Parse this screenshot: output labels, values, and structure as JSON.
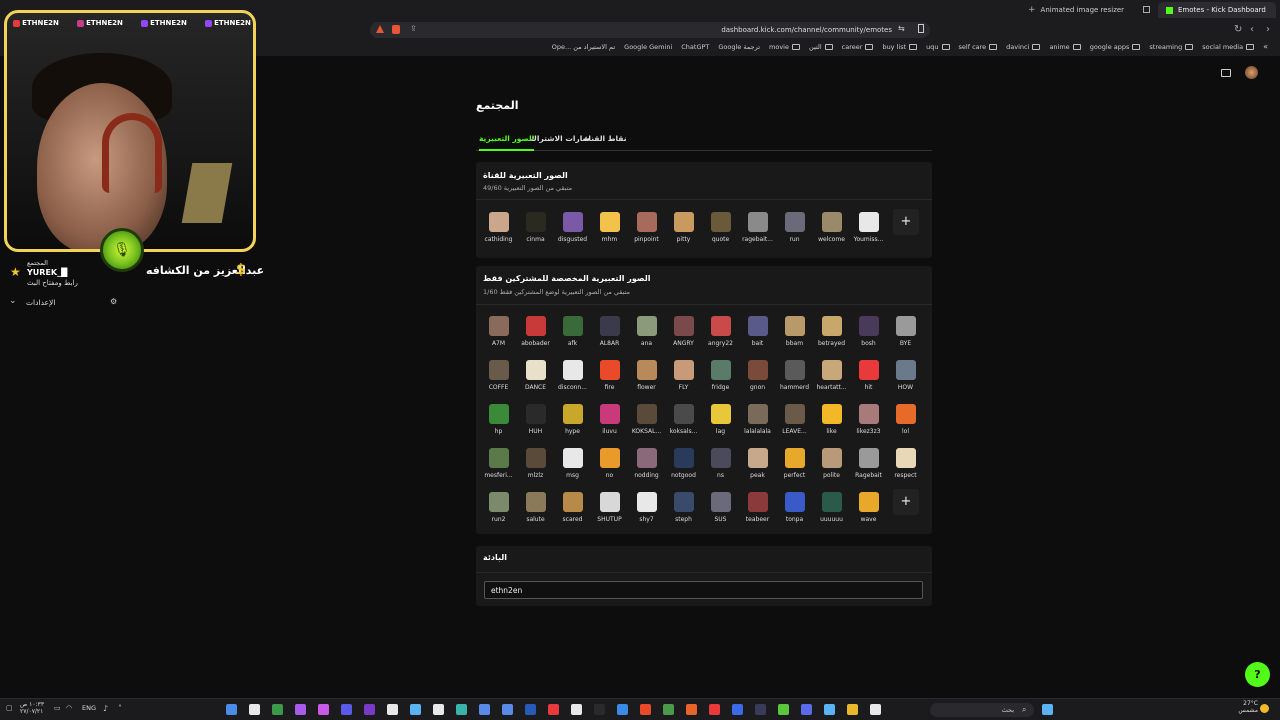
{
  "browser": {
    "tabs": [
      {
        "label": "Animated image resizer"
      },
      {
        "label": "Emotes - Kick Dashboard"
      }
    ],
    "url": "dashboard.kick.com/channel/community/emotes",
    "bookmarks": [
      "social media",
      "streaming",
      "google apps",
      "anime",
      "davinci",
      "self care",
      "uqu",
      "buy list",
      "career",
      "التين",
      "movie",
      "ترجمة Google",
      "ChatGPT",
      "Google Gemini",
      "تم الاستيراد من ...Ope"
    ]
  },
  "overlay": {
    "social_handles": [
      "ETHNE2N",
      "ETHNE2N",
      "ETHNE2N",
      "ETHNE2N"
    ],
    "alert_name": "عبدالعزيز من الكشافه",
    "alert_symbol": "$"
  },
  "sidebar": {
    "community_label": "المجتمع",
    "username": "YUREK_█",
    "link_label": "رابط ومفتاح البث",
    "settings_label": "الإعدادات"
  },
  "page": {
    "title": "المجتمع",
    "tabs": [
      {
        "label": "الصور التعبيرية",
        "active": true
      },
      {
        "label": "شارات الاشتراك",
        "active": false
      },
      {
        "label": "نقاط القناة",
        "active": false
      }
    ]
  },
  "channel_emotes": {
    "title": "الصور التعبيرية للقناة",
    "subtitle": "متبقي من الصور التعبيرية 49/60",
    "items": [
      {
        "name": "cathiding",
        "color": "#caa78a"
      },
      {
        "name": "cinma",
        "color": "#2a2a20"
      },
      {
        "name": "disgusted",
        "color": "#7a5aa8"
      },
      {
        "name": "mhm",
        "color": "#f2c24a"
      },
      {
        "name": "pinpoint",
        "color": "#a86a5a"
      },
      {
        "name": "pitty",
        "color": "#c89a60"
      },
      {
        "name": "quote",
        "color": "#6a5a3a"
      },
      {
        "name": "ragebait...",
        "color": "#8a8a8a"
      },
      {
        "name": "run",
        "color": "#6a6a7a"
      },
      {
        "name": "welcome",
        "color": "#9a8a6a"
      },
      {
        "name": "Youmiss...",
        "color": "#e8e8e8"
      }
    ]
  },
  "subscriber_emotes": {
    "title": "الصور التعبيرية المخصصة للمشتركين فقط",
    "subtitle": "متبقي من الصور التعبيرية لوضع المشتركين فقط 1/60",
    "items": [
      {
        "name": "A7M",
        "color": "#8a6a5a"
      },
      {
        "name": "abobader",
        "color": "#c83a3a"
      },
      {
        "name": "afk",
        "color": "#3a6a3a"
      },
      {
        "name": "AL8AR",
        "color": "#3a3a4a"
      },
      {
        "name": "ana",
        "color": "#8a9a7a"
      },
      {
        "name": "ANGRY",
        "color": "#7a4a4a"
      },
      {
        "name": "angry22",
        "color": "#c84a4a"
      },
      {
        "name": "bait",
        "color": "#5a5a8a"
      },
      {
        "name": "bbam",
        "color": "#b89a6a"
      },
      {
        "name": "betrayed",
        "color": "#c8a86a"
      },
      {
        "name": "bosh",
        "color": "#4a3a5a"
      },
      {
        "name": "BYE",
        "color": "#9a9a9a"
      },
      {
        "name": "COFFE",
        "color": "#6a5a4a"
      },
      {
        "name": "DANCE",
        "color": "#e8e0c8"
      },
      {
        "name": "disconn...",
        "color": "#e8e8e8"
      },
      {
        "name": "fire",
        "color": "#e84a2a"
      },
      {
        "name": "flower",
        "color": "#b88a5a"
      },
      {
        "name": "FLY",
        "color": "#c89a7a"
      },
      {
        "name": "fridge",
        "color": "#5a7a6a"
      },
      {
        "name": "gnon",
        "color": "#7a4a3a"
      },
      {
        "name": "hammerd",
        "color": "#5a5a5a"
      },
      {
        "name": "heartatt...",
        "color": "#c8a87a"
      },
      {
        "name": "hit",
        "color": "#e83a3a"
      },
      {
        "name": "HOW",
        "color": "#6a7a8a"
      },
      {
        "name": "hp",
        "color": "#3a8a3a"
      },
      {
        "name": "HUH",
        "color": "#2a2a2a"
      },
      {
        "name": "hype",
        "color": "#c8a82a"
      },
      {
        "name": "iluvu",
        "color": "#c83a7a"
      },
      {
        "name": "KOKSAL...",
        "color": "#5a4a3a"
      },
      {
        "name": "koksals...",
        "color": "#4a4a4a"
      },
      {
        "name": "lag",
        "color": "#e8c83a"
      },
      {
        "name": "lalalalala",
        "color": "#7a6a5a"
      },
      {
        "name": "LEAVE...",
        "color": "#6a5a4a"
      },
      {
        "name": "like",
        "color": "#f2b82a"
      },
      {
        "name": "likez3z3",
        "color": "#a87a7a"
      },
      {
        "name": "lol",
        "color": "#e86a2a"
      },
      {
        "name": "mesferi...",
        "color": "#5a7a4a"
      },
      {
        "name": "mlzlz",
        "color": "#5a4a3a"
      },
      {
        "name": "msg",
        "color": "#e8e8e8"
      },
      {
        "name": "no",
        "color": "#e89a2a"
      },
      {
        "name": "nodding",
        "color": "#8a6a7a"
      },
      {
        "name": "notgood",
        "color": "#2a3a5a"
      },
      {
        "name": "ns",
        "color": "#4a4a5a"
      },
      {
        "name": "peak",
        "color": "#c8a88a"
      },
      {
        "name": "perfect",
        "color": "#e8a82a"
      },
      {
        "name": "polite",
        "color": "#b89a7a"
      },
      {
        "name": "Ragebait",
        "color": "#9a9a9a"
      },
      {
        "name": "respect",
        "color": "#e8d8b8"
      },
      {
        "name": "run2",
        "color": "#7a8a6a"
      },
      {
        "name": "salute",
        "color": "#8a7a5a"
      },
      {
        "name": "scared",
        "color": "#b88a4a"
      },
      {
        "name": "SHUTUP",
        "color": "#d8d8d8"
      },
      {
        "name": "shy7",
        "color": "#e8e8e8"
      },
      {
        "name": "steph",
        "color": "#3a4a6a"
      },
      {
        "name": "SUS",
        "color": "#6a6a7a"
      },
      {
        "name": "teabeer",
        "color": "#8a3a3a"
      },
      {
        "name": "tonpa",
        "color": "#3a5ac8"
      },
      {
        "name": "uuuuuu",
        "color": "#2a5a4a"
      },
      {
        "name": "wave",
        "color": "#e8a82a"
      }
    ]
  },
  "username_card": {
    "title": "البادئة",
    "value": "ethn2en"
  },
  "taskbar": {
    "search_placeholder": "بحث",
    "lang": "ENG",
    "weather": "27°C",
    "weather_sub": "مشمس",
    "time": "١٠:٣٣ ص",
    "date": "٢٧/٠٧/٢١"
  }
}
